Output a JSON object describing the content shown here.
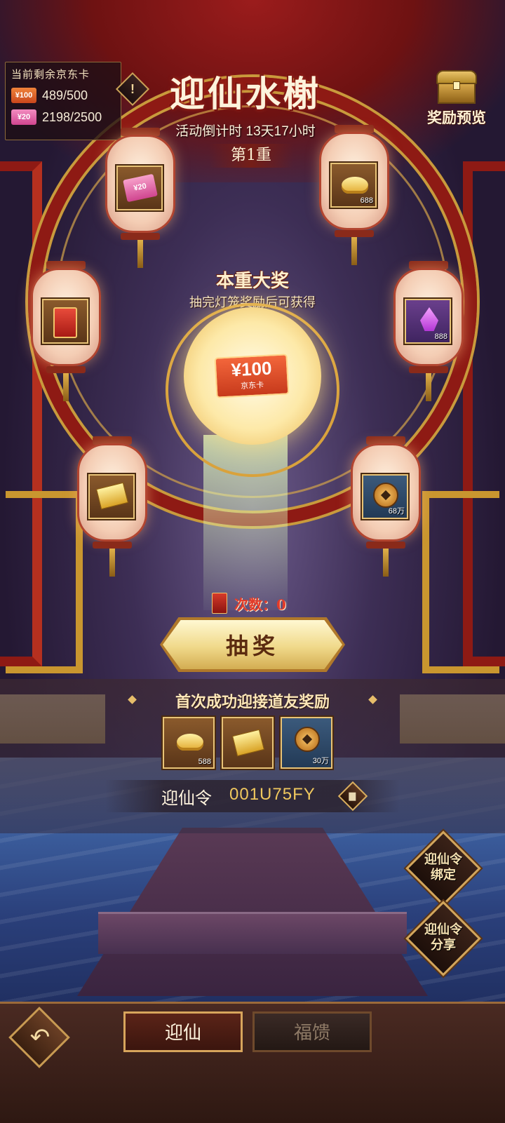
{
  "card_panel": {
    "title": "当前剩余京东卡",
    "cards": [
      {
        "badge": "¥100",
        "count": "489/500"
      },
      {
        "badge": "¥20",
        "count": "2198/2500"
      }
    ]
  },
  "header": {
    "title": "迎仙水榭",
    "countdown": "活动倒计时 13天17小时",
    "tier": "第1重"
  },
  "reward_preview": {
    "label": "奖励预览",
    "icon": "treasure-chest-icon"
  },
  "info_icon": {
    "symbol": "!"
  },
  "lanterns": [
    {
      "item": "jd-card-20",
      "badge": "¥20",
      "qty": ""
    },
    {
      "item": "gold-ingot",
      "qty": "688"
    },
    {
      "item": "red-envelope-pack",
      "qty": ""
    },
    {
      "item": "purple-crystal",
      "qty": "888"
    },
    {
      "item": "gold-paper",
      "qty": ""
    },
    {
      "item": "copper-coin",
      "qty": "68万"
    }
  ],
  "grand_prize": {
    "title": "本重大奖",
    "subtitle": "抽完灯笼奖励后可获得",
    "card_amount": "¥100",
    "card_brand": "京东卡"
  },
  "draw": {
    "count_label": "次数：0",
    "button_label": "抽奖"
  },
  "first_reward": {
    "title": "首次成功迎接道友奖励",
    "items": [
      {
        "item": "gold-ingot",
        "qty": "588"
      },
      {
        "item": "gold-paper",
        "qty": ""
      },
      {
        "item": "copper-coin",
        "qty": "30万"
      }
    ]
  },
  "invite_code": {
    "label": "迎仙令",
    "value": "001U75FY"
  },
  "side_buttons": {
    "bind_line1": "迎仙令",
    "bind_line2": "绑定",
    "share_line1": "迎仙令",
    "share_line2": "分享"
  },
  "bottom_tabs": {
    "active": "迎仙",
    "inactive": "福馈"
  },
  "colors": {
    "accent_gold": "#d8a55c",
    "lantern_red": "#b24530",
    "count_red": "#e23b2a"
  }
}
